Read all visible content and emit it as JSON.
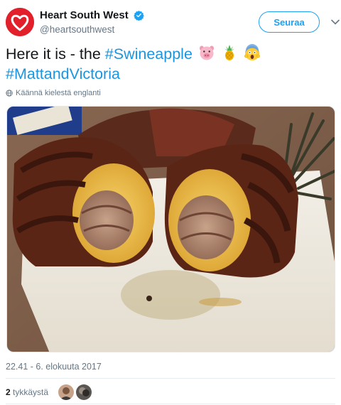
{
  "account": {
    "display_name": "Heart South West",
    "handle": "@heartsouthwest",
    "verified": true,
    "brand_color": "#e2202c"
  },
  "follow_button": {
    "label": "Seuraa"
  },
  "menu": {
    "icon": "chevron-down-icon"
  },
  "tweet": {
    "text_prefix": "Here it is - the ",
    "hashtag_1": "#Swineapple",
    "emojis": [
      "pig-face-icon",
      "pineapple-icon",
      "screaming-face-icon"
    ],
    "hashtag_2": "#MattandVictoria",
    "hashtag_color": "#1b95e0"
  },
  "translate": {
    "label": "Käännä kielestä englanti",
    "icon": "globe-icon"
  },
  "media": {
    "description_icon": "photo"
  },
  "timestamp": "22.41 - 6. elokuuta 2017",
  "stats": {
    "likes_count": "2",
    "likes_label": "tykkäystä",
    "liker_avatars": 2
  }
}
